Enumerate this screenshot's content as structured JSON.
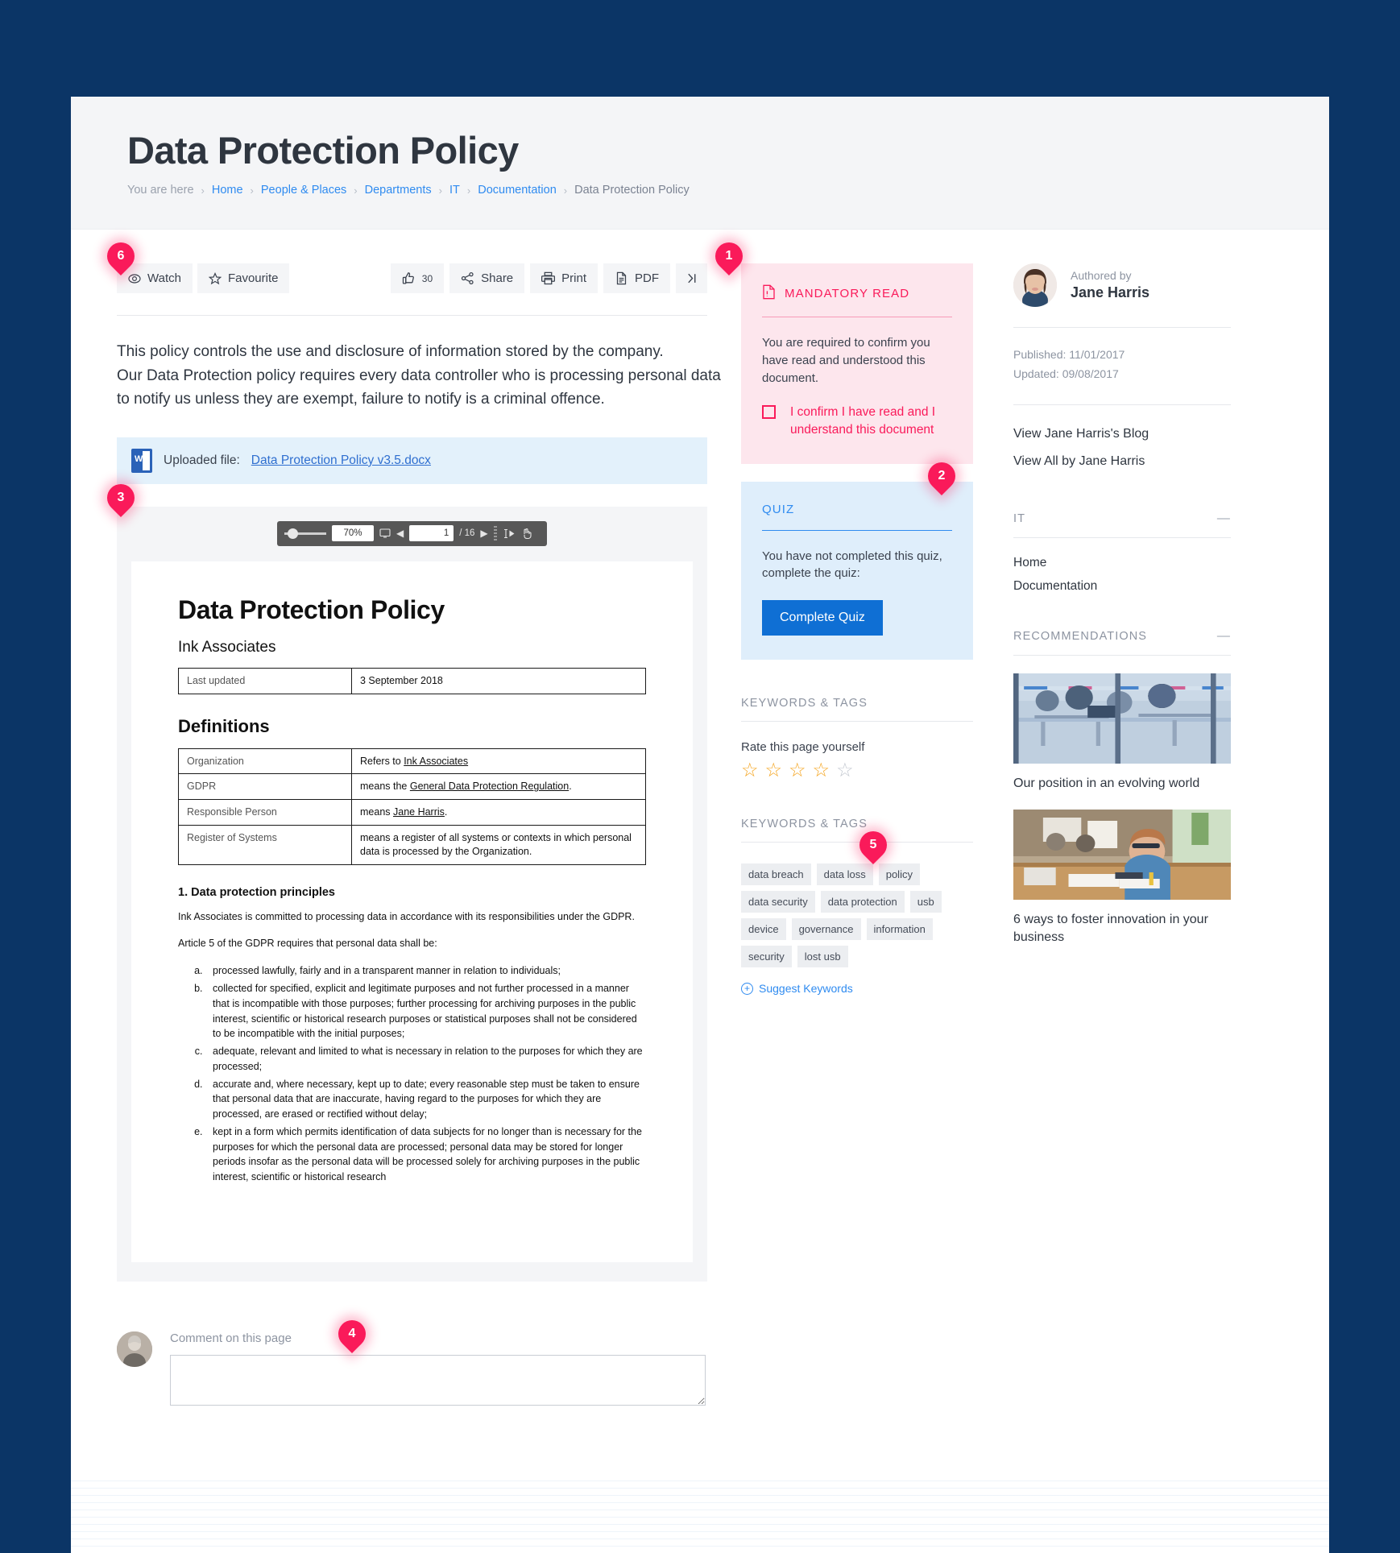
{
  "header": {
    "title": "Data Protection Policy",
    "breadcrumb": {
      "prefix": "You are here",
      "items": [
        "Home",
        "People & Places",
        "Departments",
        "IT",
        "Documentation"
      ],
      "current": "Data Protection Policy",
      "separator": "›"
    }
  },
  "toolbar": {
    "watch_label": "Watch",
    "favourite_label": "Favourite",
    "like_count": "30",
    "share_label": "Share",
    "print_label": "Print",
    "pdf_label": "PDF",
    "collapse_label": "›|"
  },
  "intro": {
    "line1": "This policy controls the use and disclosure of information stored by the company.",
    "line2": "Our Data Protection policy requires every data controller who is processing personal data",
    "line3": "to notify us unless they are exempt, failure to notify is a criminal offence."
  },
  "file_bar": {
    "prefix": "Uploaded file:",
    "filename": "Data Protection Policy v3.5.docx",
    "icon_letter": "W"
  },
  "viewer": {
    "zoom_level": "70%",
    "page_number": "1",
    "page_total": "/ 16"
  },
  "document": {
    "title": "Data Protection Policy",
    "subtitle": "Ink Associates",
    "meta_table": {
      "key": "Last updated",
      "value": "3 September 2018"
    },
    "definitions_heading": "Definitions",
    "definitions": [
      {
        "term": "Organization",
        "definition_prefix": "Refers to ",
        "definition_underlined": "Ink Associates",
        "definition_suffix": ""
      },
      {
        "term": "GDPR",
        "definition_prefix": "means the ",
        "definition_underlined": "General Data Protection Regulation",
        "definition_suffix": "."
      },
      {
        "term": "Responsible Person",
        "definition_prefix": "means ",
        "definition_underlined": "Jane Harris",
        "definition_suffix": "."
      },
      {
        "term": "Register of Systems",
        "definition_prefix": "means a register of all systems or contexts in which personal data is processed by the Organization.",
        "definition_underlined": "",
        "definition_suffix": ""
      }
    ],
    "section_heading": "1. Data protection principles",
    "paragraph1": "Ink Associates is committed to processing data in accordance with its responsibilities under the GDPR.",
    "paragraph2": "Article 5 of the GDPR requires that personal data shall be:",
    "list": [
      "processed lawfully, fairly and in a transparent manner in relation to individuals;",
      "collected for specified, explicit and legitimate purposes and not further processed in a manner that is incompatible with those purposes; further processing for archiving purposes in the public interest, scientific or historical research purposes or statistical purposes shall not be considered to be incompatible with the initial purposes;",
      "adequate, relevant and limited to what is necessary in relation to the purposes for which they are processed;",
      "accurate and, where necessary, kept up to date; every reasonable step must be taken to ensure that personal data that are inaccurate, having regard to the purposes for which they are processed, are erased or rectified without delay;",
      "kept in a form which permits identification of data subjects for no longer than is necessary for the purposes for which the personal data are processed; personal data may be stored for longer periods insofar as the personal data will be processed solely for archiving purposes in the public interest, scientific or historical research"
    ]
  },
  "mandatory_read": {
    "title": "MANDATORY READ",
    "body": "You are required to confirm you have read and understood this document.",
    "confirm_label": "I confirm I have read and I understand this document"
  },
  "quiz": {
    "title": "QUIZ",
    "body": "You have not completed this quiz, complete the quiz:",
    "button_label": "Complete Quiz"
  },
  "rating": {
    "section_title": "KEYWORDS & TAGS",
    "prompt": "Rate this page yourself",
    "filled": 4,
    "total": 5
  },
  "keywords": {
    "section_title": "KEYWORDS & TAGS",
    "tags": [
      "data breach",
      "data loss",
      "policy",
      "data security",
      "data protection",
      "usb",
      "device",
      "governance",
      "information",
      "security",
      "lost usb"
    ],
    "suggest_label": "Suggest Keywords"
  },
  "author_panel": {
    "authored_by_label": "Authored by",
    "author_name": "Jane Harris",
    "published": "Published: 11/01/2017",
    "updated": "Updated: 09/08/2017",
    "links": [
      "View Jane Harris's Blog",
      "View All by Jane Harris"
    ]
  },
  "it_section": {
    "title": "IT",
    "collapse_glyph": "—",
    "links": [
      "Home",
      "Documentation"
    ]
  },
  "recommendations": {
    "title": "RECOMMENDATIONS",
    "collapse_glyph": "—",
    "items": [
      {
        "caption": "Our position in an evolving world"
      },
      {
        "caption": "6 ways to foster innovation in your business"
      }
    ]
  },
  "comment": {
    "label": "Comment on this page",
    "placeholder": ""
  },
  "pins": [
    {
      "number": "1"
    },
    {
      "number": "2"
    },
    {
      "number": "3"
    },
    {
      "number": "4"
    },
    {
      "number": "5"
    },
    {
      "number": "6"
    }
  ],
  "colors": {
    "brand_blue": "#0b3566",
    "link_blue": "#2f8bf0",
    "pin_pink": "#fa1a5a",
    "mandatory_bg": "#fde6ed",
    "quiz_bg": "#dfeefb",
    "star_gold": "#f5a623"
  }
}
